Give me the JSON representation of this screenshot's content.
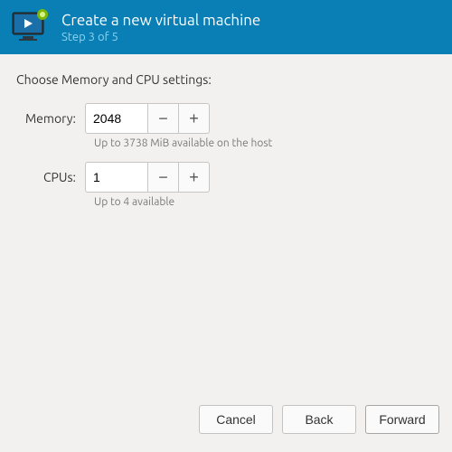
{
  "header": {
    "title": "Create a new virtual machine",
    "subtitle": "Step 3 of 5"
  },
  "section_label": "Choose Memory and CPU settings:",
  "memory": {
    "label": "Memory:",
    "value": "2048",
    "hint": "Up to 3738 MiB available on the host"
  },
  "cpus": {
    "label": "CPUs:",
    "value": "1",
    "hint": "Up to 4 available"
  },
  "buttons": {
    "cancel": "Cancel",
    "back": "Back",
    "forward": "Forward"
  },
  "glyphs": {
    "minus": "−",
    "plus": "+"
  }
}
